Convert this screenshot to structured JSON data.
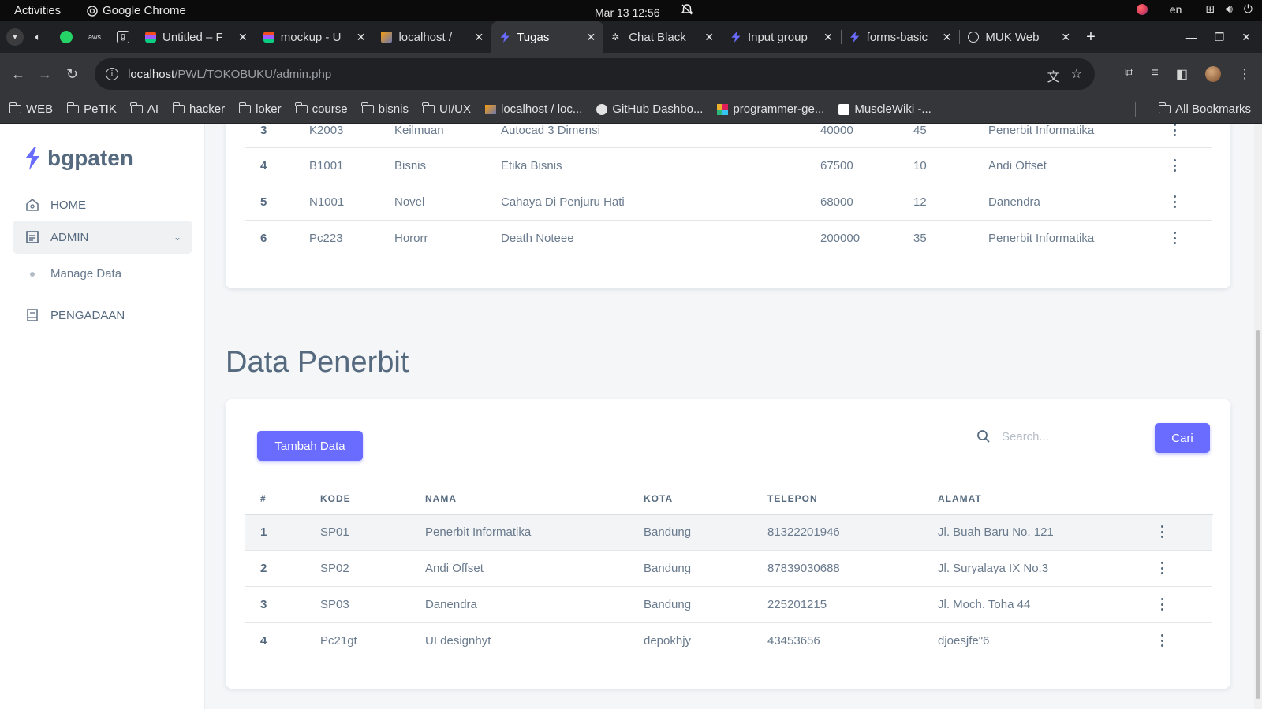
{
  "system_bar": {
    "activities": "Activities",
    "app_name": "Google Chrome",
    "clock": "Mar 13  12:56",
    "lang": "en"
  },
  "tabs": [
    {
      "title": "Untitled – F",
      "icon": "figma-icon"
    },
    {
      "title": "mockup - U",
      "icon": "figma-icon"
    },
    {
      "title": "localhost /",
      "icon": "phpmyadmin-icon"
    },
    {
      "title": "Tugas",
      "icon": "bolt-icon",
      "active": true
    },
    {
      "title": "Chat Black",
      "icon": "spark-icon"
    },
    {
      "title": "Input group",
      "icon": "bolt-icon"
    },
    {
      "title": "forms-basic",
      "icon": "bolt-icon"
    },
    {
      "title": "MUK Web",
      "icon": "globe-icon"
    }
  ],
  "address_bar": {
    "host": "localhost",
    "path": "/PWL/TOKOBUKU/admin.php"
  },
  "bookmarks": {
    "items": [
      "WEB",
      "PeTIK",
      "AI",
      "hacker",
      "loker",
      "course",
      "bisnis",
      "UI/UX",
      "localhost / loc...",
      "GitHub Dashbo...",
      "programmer-ge...",
      "MuscleWiki -..."
    ],
    "all": "All Bookmarks"
  },
  "sidebar": {
    "brand": "bgpaten",
    "menu": [
      {
        "label": "HOME",
        "icon": "home-icon"
      },
      {
        "label": "ADMIN",
        "icon": "list-icon"
      },
      {
        "label": "PENGADAAN",
        "icon": "book-icon"
      }
    ],
    "submenu": [
      "Manage Data"
    ]
  },
  "buku_rows": [
    {
      "no": "3",
      "kode": "K2003",
      "kategori": "Keilmuan",
      "nama": "Autocad 3 Dimensi",
      "harga": "40000",
      "stok": "45",
      "penerbit": "Penerbit Informatika"
    },
    {
      "no": "4",
      "kode": "B1001",
      "kategori": "Bisnis",
      "nama": "Etika Bisnis",
      "harga": "67500",
      "stok": "10",
      "penerbit": "Andi Offset"
    },
    {
      "no": "5",
      "kode": "N1001",
      "kategori": "Novel",
      "nama": "Cahaya Di Penjuru Hati",
      "harga": "68000",
      "stok": "12",
      "penerbit": "Danendra"
    },
    {
      "no": "6",
      "kode": "Pc223",
      "kategori": "Hororr",
      "nama": "Death Noteee",
      "harga": "200000",
      "stok": "35",
      "penerbit": "Penerbit Informatika"
    }
  ],
  "penerbit": {
    "title": "Data Penerbit",
    "add_button": "Tambah Data",
    "search_placeholder": "Search...",
    "search_button": "Cari",
    "headers": [
      "#",
      "KODE",
      "NAMA",
      "KOTA",
      "TELEPON",
      "ALAMAT"
    ],
    "rows": [
      {
        "no": "1",
        "kode": "SP01",
        "nama": "Penerbit Informatika",
        "kota": "Bandung",
        "telepon": "81322201946",
        "alamat": "Jl. Buah Baru No. 121"
      },
      {
        "no": "2",
        "kode": "SP02",
        "nama": "Andi Offset",
        "kota": "Bandung",
        "telepon": "87839030688",
        "alamat": "Jl. Suryalaya IX No.3"
      },
      {
        "no": "3",
        "kode": "SP03",
        "nama": "Danendra",
        "kota": "Bandung",
        "telepon": "225201215",
        "alamat": "Jl. Moch. Toha 44"
      },
      {
        "no": "4",
        "kode": "Pc21gt",
        "nama": "UI designhyt",
        "kota": "depokhjy",
        "telepon": "43453656",
        "alamat": "djoesjfe\"6"
      }
    ]
  },
  "colors": {
    "primary": "#696cff",
    "text": "#566a7f",
    "chrome_dark": "#202124"
  }
}
